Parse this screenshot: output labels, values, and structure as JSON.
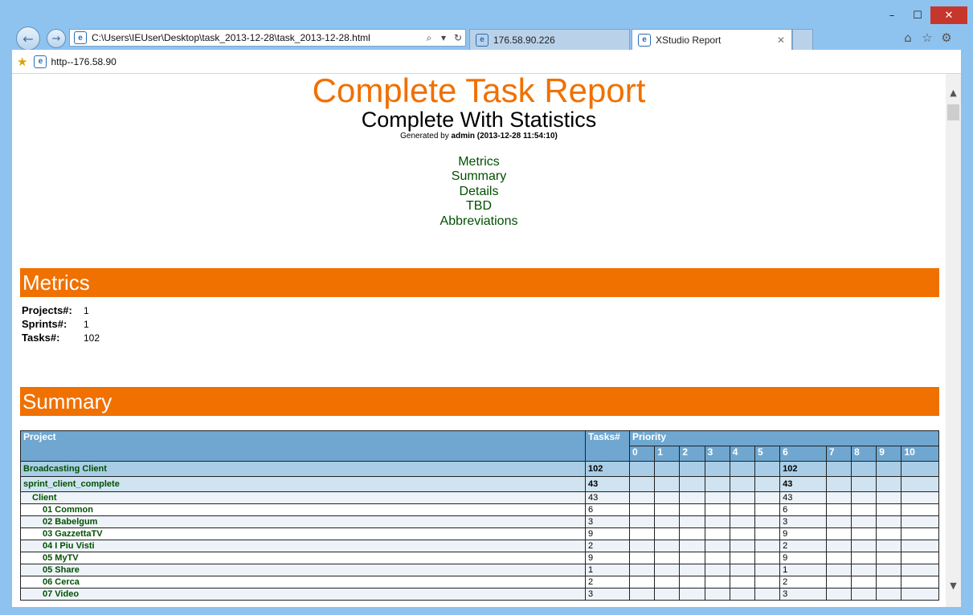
{
  "browser": {
    "address_url": "C:\\Users\\IEUser\\Desktop\\task_2013-12-28\\task_2013-12-28.html",
    "tabs": [
      {
        "label": "176.58.90.226"
      },
      {
        "label": "XStudio Report"
      }
    ],
    "favorites": [
      {
        "label": "http--176.58.90"
      }
    ],
    "window_controls": {
      "minimize": "–",
      "maximize": "☐",
      "close": "✕"
    }
  },
  "report": {
    "title": "Complete Task Report",
    "subtitle": "Complete With Statistics",
    "generated_prefix": "Generated by",
    "generated_user": "admin",
    "generated_time": "(2013-12-28 11:54:10)",
    "toc": [
      "Metrics",
      "Summary",
      "Details",
      "TBD",
      "Abbreviations"
    ]
  },
  "metrics": {
    "heading": "Metrics",
    "rows": [
      {
        "label": "Projects#:",
        "value": "1"
      },
      {
        "label": "Sprints#:",
        "value": "1"
      },
      {
        "label": "Tasks#:",
        "value": "102"
      }
    ]
  },
  "summary": {
    "heading": "Summary",
    "headers": {
      "project": "Project",
      "tasks": "Tasks#",
      "priority": "Priority"
    },
    "priority_levels": [
      "0",
      "1",
      "2",
      "3",
      "4",
      "5",
      "6",
      "7",
      "8",
      "9",
      "10"
    ],
    "rows": [
      {
        "name": "Broadcasting Client",
        "tasks": "102",
        "p6": "102",
        "kind": "proj"
      },
      {
        "name": "sprint_client_complete",
        "tasks": "43",
        "p6": "43",
        "kind": "sprint"
      },
      {
        "name": "Client",
        "tasks": "43",
        "p6": "43",
        "kind": "alt"
      },
      {
        "name": "01 Common",
        "tasks": "6",
        "p6": "6",
        "kind": "plain"
      },
      {
        "name": "02 Babelgum",
        "tasks": "3",
        "p6": "3",
        "kind": "alt"
      },
      {
        "name": "03 GazzettaTV",
        "tasks": "9",
        "p6": "9",
        "kind": "plain"
      },
      {
        "name": "04 I Piu Visti",
        "tasks": "2",
        "p6": "2",
        "kind": "alt"
      },
      {
        "name": "05 MyTV",
        "tasks": "9",
        "p6": "9",
        "kind": "plain"
      },
      {
        "name": "05 Share",
        "tasks": "1",
        "p6": "1",
        "kind": "alt"
      },
      {
        "name": "06 Cerca",
        "tasks": "2",
        "p6": "2",
        "kind": "plain"
      },
      {
        "name": "07 Video",
        "tasks": "3",
        "p6": "3",
        "kind": "alt"
      }
    ]
  }
}
